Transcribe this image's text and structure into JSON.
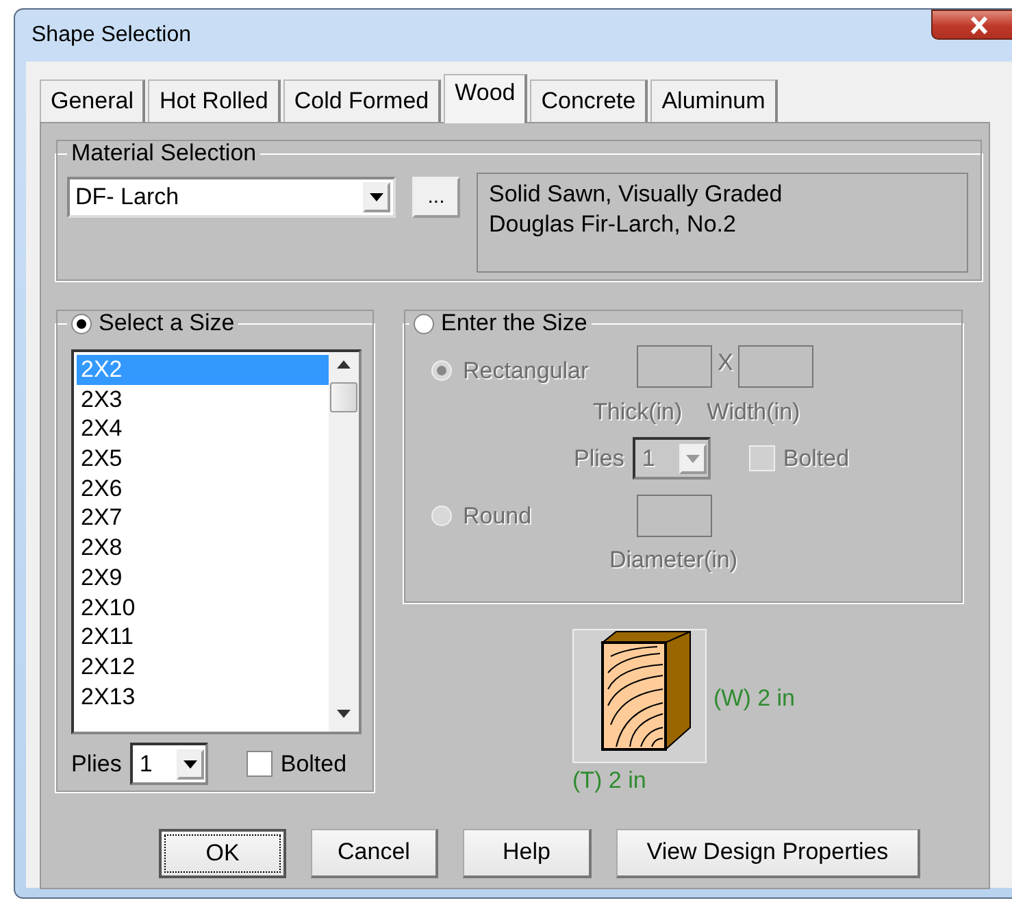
{
  "window": {
    "title": "Shape Selection"
  },
  "tabs": [
    {
      "label": "General",
      "selected": false
    },
    {
      "label": "Hot Rolled",
      "selected": false
    },
    {
      "label": "Cold Formed",
      "selected": false
    },
    {
      "label": "Wood",
      "selected": true
    },
    {
      "label": "Concrete",
      "selected": false
    },
    {
      "label": "Aluminum",
      "selected": false
    }
  ],
  "material_selection": {
    "label": "Material Selection",
    "material": "DF- Larch",
    "browse_button": "...",
    "description": [
      "Solid Sawn, Visually Graded",
      "Douglas Fir-Larch, No.2"
    ]
  },
  "select_size": {
    "label": "Select a Size",
    "selected": true,
    "sizes": [
      {
        "label": "2X2",
        "selected": true
      },
      {
        "label": "2X3",
        "selected": false
      },
      {
        "label": "2X4",
        "selected": false
      },
      {
        "label": "2X5",
        "selected": false
      },
      {
        "label": "2X6",
        "selected": false
      },
      {
        "label": "2X7",
        "selected": false
      },
      {
        "label": "2X8",
        "selected": false
      },
      {
        "label": "2X9",
        "selected": false
      },
      {
        "label": "2X10",
        "selected": false
      },
      {
        "label": "2X11",
        "selected": false
      },
      {
        "label": "2X12",
        "selected": false
      },
      {
        "label": "2X13",
        "selected": false
      }
    ],
    "plies_label": "Plies",
    "plies": "1",
    "bolted": {
      "label": "Bolted",
      "checked": false
    }
  },
  "enter_size": {
    "label": "Enter the Size",
    "selected": false,
    "disabled": true,
    "rectangular": {
      "label": "Rectangular",
      "selected": true
    },
    "times_sign": "X",
    "thick_label": "Thick(in)",
    "width_label": "Width(in)",
    "plies_label": "Plies",
    "plies": "1",
    "bolted": {
      "label": "Bolted",
      "checked": false
    },
    "round": {
      "label": "Round",
      "selected": false
    },
    "diameter_label": "Diameter(in)"
  },
  "preview": {
    "width_label": "(W) 2 in",
    "thickness_label": "(T) 2 in"
  },
  "buttons": [
    {
      "label": "OK",
      "default": true
    },
    {
      "label": "Cancel",
      "default": false
    },
    {
      "label": "Help",
      "default": false
    },
    {
      "label": "View Design Properties",
      "default": false
    }
  ]
}
